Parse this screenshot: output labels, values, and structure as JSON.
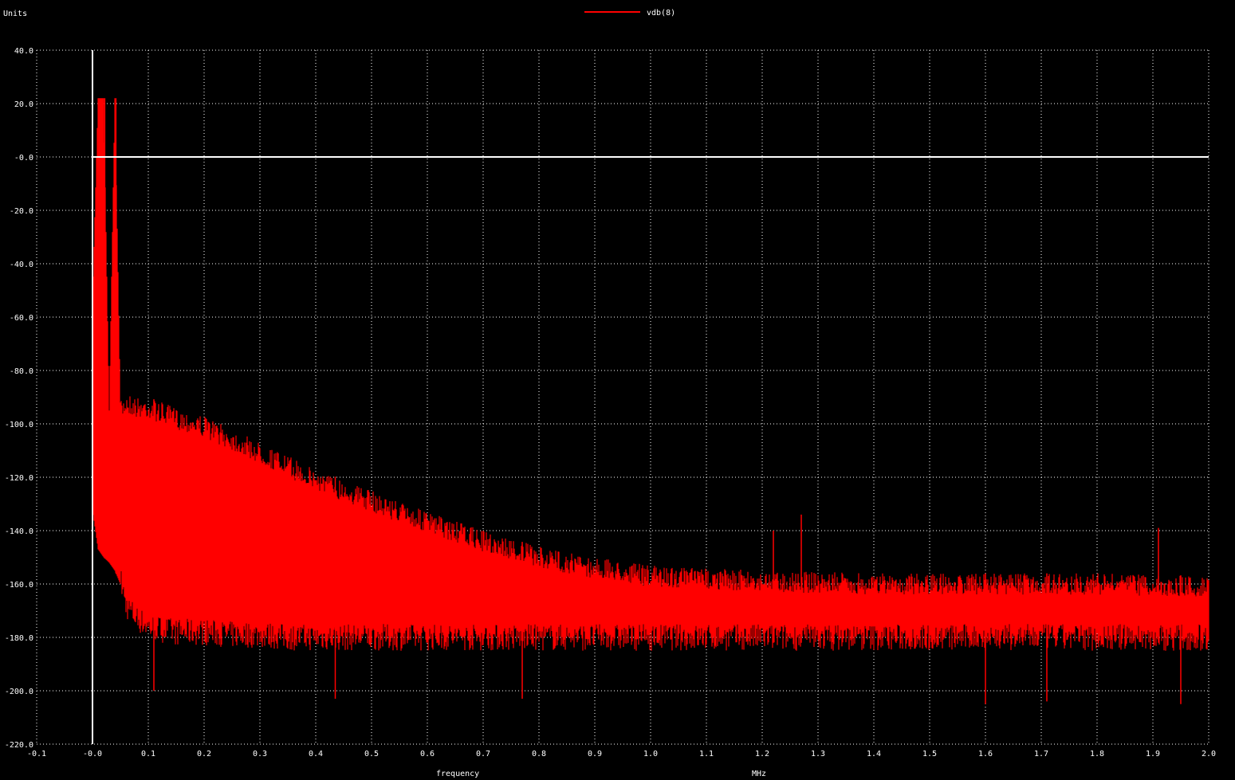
{
  "colors": {
    "background": "#000000",
    "grid": "#ffffff",
    "trace": "#ff0000",
    "text": "#ffffff"
  },
  "chart_data": {
    "type": "line",
    "ylabel": "Units",
    "xlabel": "frequency",
    "xunit": "MHz",
    "legend": "top-center",
    "grid": true,
    "xlim": [
      -0.1,
      2.0
    ],
    "ylim": [
      -220,
      40
    ],
    "x_ticks": [
      "-0.1",
      "-0.0",
      "0.1",
      "0.2",
      "0.3",
      "0.4",
      "0.5",
      "0.6",
      "0.7",
      "0.8",
      "0.9",
      "1.0",
      "1.1",
      "1.2",
      "1.3",
      "1.4",
      "1.5",
      "1.6",
      "1.7",
      "1.8",
      "1.9",
      "2.0"
    ],
    "y_ticks": [
      "40.0",
      "20.0",
      "-0.0",
      "-20.0",
      "-40.0",
      "-60.0",
      "-80.0",
      "-100.0",
      "-120.0",
      "-140.0",
      "-160.0",
      "-180.0",
      "-200.0",
      "-220.0"
    ],
    "series": [
      {
        "name": "vdb(8)",
        "color": "#ff0000",
        "x": [
          0.0,
          0.01,
          0.02,
          0.03,
          0.04,
          0.05,
          0.06,
          0.08,
          0.1,
          0.15,
          0.2,
          0.25,
          0.3,
          0.35,
          0.4,
          0.5,
          0.6,
          0.7,
          0.8,
          0.9,
          1.0,
          1.2,
          1.4,
          1.6,
          1.8,
          2.0
        ],
        "peak_db": [
          -56,
          22,
          22,
          -95,
          22,
          -92,
          -88,
          -90,
          -90,
          -94,
          -97,
          -102,
          -107,
          -112,
          -117,
          -125,
          -133,
          -140,
          -146,
          -150,
          -153,
          -155,
          -156,
          -156,
          -156,
          -157
        ],
        "floor_db": [
          -132,
          -147,
          -150,
          -152,
          -155,
          -160,
          -170,
          -175,
          -178,
          -180,
          -180,
          -181,
          -181,
          -182,
          -182,
          -182,
          -182,
          -182,
          -182,
          -182,
          -182,
          -182,
          -182,
          -182,
          -182,
          -182
        ],
        "spikes": [
          {
            "x": 0.01,
            "y": 22
          },
          {
            "x": 0.022,
            "y": 22
          },
          {
            "x": 0.042,
            "y": 22
          },
          {
            "x": 1.22,
            "y": -140
          },
          {
            "x": 1.27,
            "y": -134
          },
          {
            "x": 1.91,
            "y": -139
          },
          {
            "x": 0.11,
            "y": -200
          },
          {
            "x": 0.435,
            "y": -203
          },
          {
            "x": 0.77,
            "y": -203
          },
          {
            "x": 1.6,
            "y": -205
          },
          {
            "x": 1.71,
            "y": -204
          },
          {
            "x": 1.95,
            "y": -205
          }
        ]
      }
    ],
    "reference_lines": [
      {
        "axis": "y",
        "value": 0
      },
      {
        "axis": "x",
        "value": 0
      }
    ]
  }
}
